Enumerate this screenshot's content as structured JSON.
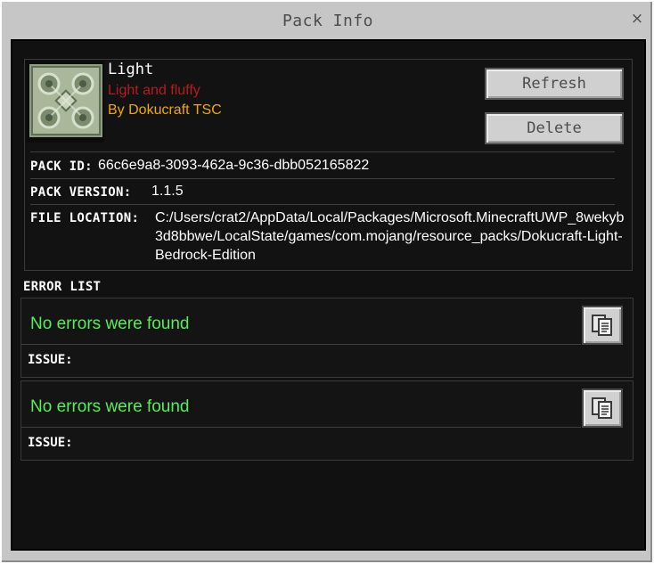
{
  "dialog": {
    "title": "Pack Info",
    "close_glyph": "×"
  },
  "pack": {
    "name": "Light",
    "description": "Light and fluffy",
    "author": "By Dokucraft TSC",
    "icon": "pack-thumbnail-icon",
    "colors": {
      "description": "#b01e1e",
      "author": "#f0a800"
    }
  },
  "actions": {
    "refresh_label": "Refresh",
    "delete_label": "Delete"
  },
  "properties": {
    "pack_id_label": "PACK ID:",
    "pack_id_value": "66c6e9a8-3093-462a-9c36-dbb052165822",
    "version_label": "PACK VERSION:",
    "version_value": "1.1.5",
    "location_label": "FILE LOCATION:",
    "location_value": "C:/Users/crat2/AppData/Local/Packages/Microsoft.MinecraftUWP_8wekyb3d8bbwe/LocalState/games/com.mojang/resource_packs/Dokucraft-Light-Bedrock-Edition"
  },
  "errors": {
    "section_title": "ERROR LIST",
    "status_color": "#55ee55",
    "items": [
      {
        "message": "No errors were found",
        "issue_label": "ISSUE:",
        "copy_icon": "copy-icon"
      },
      {
        "message": "No errors were found",
        "issue_label": "ISSUE:",
        "copy_icon": "copy-icon"
      }
    ]
  }
}
